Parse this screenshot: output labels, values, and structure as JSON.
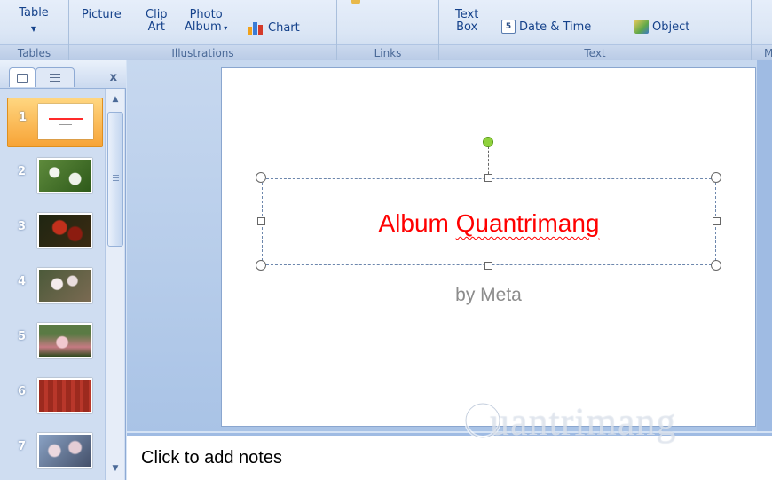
{
  "ribbon": {
    "groups": [
      {
        "label": "Tables"
      },
      {
        "label": "Illustrations"
      },
      {
        "label": "Links"
      },
      {
        "label": "Text"
      },
      {
        "label": "M"
      }
    ],
    "table_label": "Table",
    "picture_label": "Picture",
    "clip_art_label_1": "Clip",
    "clip_art_label_2": "Art",
    "photo_album_label_1": "Photo",
    "photo_album_label_2": "Album",
    "chart_label": "Chart",
    "text_box_label_1": "Text",
    "text_box_label_2": "Box",
    "date_time_label": "Date & Time",
    "object_label": "Object"
  },
  "left_pane": {
    "close_label": "x",
    "slides": [
      {
        "number": "1",
        "selected": true
      },
      {
        "number": "2"
      },
      {
        "number": "3"
      },
      {
        "number": "4"
      },
      {
        "number": "5"
      },
      {
        "number": "6"
      },
      {
        "number": "7"
      }
    ]
  },
  "slide": {
    "title_part1": "Album ",
    "title_part2": "Quantrimang",
    "subtitle": "by Meta"
  },
  "notes": {
    "placeholder": "Click to add notes"
  },
  "watermark": {
    "text": "Quantrimang"
  },
  "colors": {
    "title": "#ff0000",
    "subtitle": "#8c8c8c",
    "selected_slide": "#f7a336",
    "ribbon_text": "#15428b"
  }
}
